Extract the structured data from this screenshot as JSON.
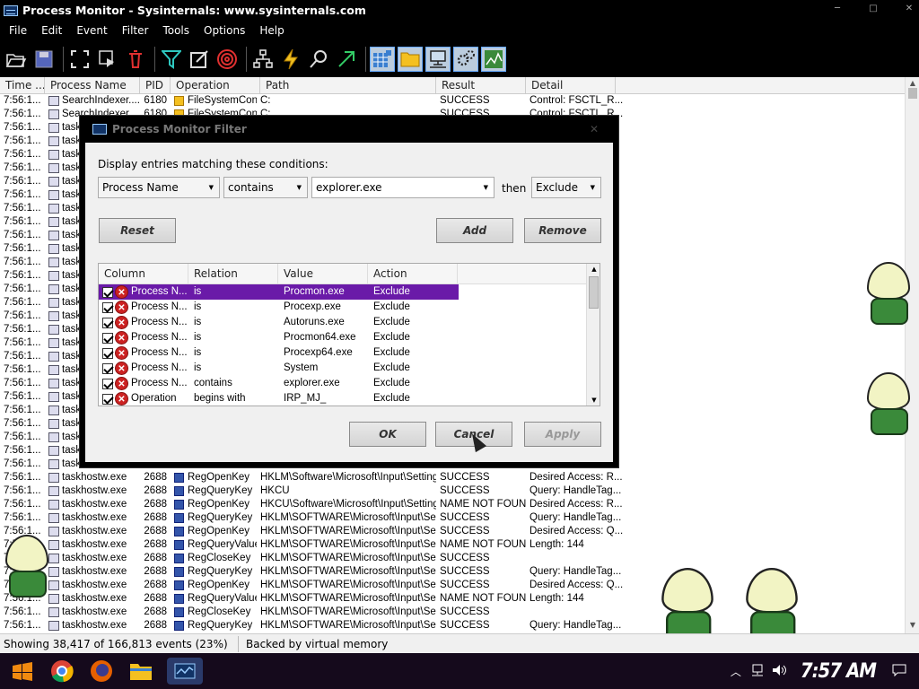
{
  "window": {
    "title": "Process Monitor - Sysinternals: www.sysinternals.com"
  },
  "menu": [
    "File",
    "Edit",
    "Event",
    "Filter",
    "Tools",
    "Options",
    "Help"
  ],
  "toolbar": [
    "open-icon",
    "save-icon",
    "autoscroll-icon",
    "clear-icon",
    "delete-icon",
    "filter-icon",
    "highlight-icon",
    "target-icon",
    "tree-icon",
    "capture-events-icon",
    "find-icon",
    "jump-icon",
    "registry-icon",
    "filesystem-icon",
    "network-icon",
    "process-icon",
    "profiling-icon"
  ],
  "columns": [
    "Time ...",
    "Process Name",
    "PID",
    "Operation",
    "Path",
    "Result",
    "Detail"
  ],
  "rows_top": [
    {
      "time": "7:56:1...",
      "proc": "SearchIndexer....",
      "pid": "6180",
      "op": "FileSystemControl",
      "path": "C:",
      "res": "SUCCESS",
      "det": "Control: FSCTL_R..."
    },
    {
      "time": "7:56:1...",
      "proc": "SearchIndexer....",
      "pid": "6180",
      "op": "FileSystemControl",
      "path": "C:",
      "res": "SUCCESS",
      "det": "Control: FSCTL_R..."
    }
  ],
  "rows_hidden_time": "7:56:1...",
  "rows_hidden_proc": "taskh",
  "rows_bottom": [
    {
      "time": "7:56:1...",
      "proc": "taskhostw.exe",
      "pid": "2688",
      "op": "RegOpenKey",
      "path": "HKLM\\Software\\Microsoft\\Input\\Settings",
      "res": "SUCCESS",
      "det": "Desired Access: R..."
    },
    {
      "time": "7:56:1...",
      "proc": "taskhostw.exe",
      "pid": "2688",
      "op": "RegQueryKey",
      "path": "HKCU",
      "res": "SUCCESS",
      "det": "Query: HandleTag..."
    },
    {
      "time": "7:56:1...",
      "proc": "taskhostw.exe",
      "pid": "2688",
      "op": "RegOpenKey",
      "path": "HKCU\\Software\\Microsoft\\Input\\Settings",
      "res": "NAME NOT FOUND",
      "det": "Desired Access: R..."
    },
    {
      "time": "7:56:1...",
      "proc": "taskhostw.exe",
      "pid": "2688",
      "op": "RegQueryKey",
      "path": "HKLM\\SOFTWARE\\Microsoft\\Input\\Se...",
      "res": "SUCCESS",
      "det": "Query: HandleTag..."
    },
    {
      "time": "7:56:1...",
      "proc": "taskhostw.exe",
      "pid": "2688",
      "op": "RegOpenKey",
      "path": "HKLM\\SOFTWARE\\Microsoft\\Input\\Se...",
      "res": "SUCCESS",
      "det": "Desired Access: Q..."
    },
    {
      "time": "7:56:1...",
      "proc": "taskhostw.exe",
      "pid": "2688",
      "op": "RegQueryValue",
      "path": "HKLM\\SOFTWARE\\Microsoft\\Input\\Se...",
      "res": "NAME NOT FOUND",
      "det": "Length: 144"
    },
    {
      "time": "7:56:1...",
      "proc": "taskhostw.exe",
      "pid": "2688",
      "op": "RegCloseKey",
      "path": "HKLM\\SOFTWARE\\Microsoft\\Input\\Se...",
      "res": "SUCCESS",
      "det": ""
    },
    {
      "time": "7:56:1...",
      "proc": "taskhostw.exe",
      "pid": "2688",
      "op": "RegQueryKey",
      "path": "HKLM\\SOFTWARE\\Microsoft\\Input\\Se...",
      "res": "SUCCESS",
      "det": "Query: HandleTag..."
    },
    {
      "time": "7:56:1...",
      "proc": "taskhostw.exe",
      "pid": "2688",
      "op": "RegOpenKey",
      "path": "HKLM\\SOFTWARE\\Microsoft\\Input\\Se...",
      "res": "SUCCESS",
      "det": "Desired Access: Q..."
    },
    {
      "time": "7:56:1...",
      "proc": "taskhostw.exe",
      "pid": "2688",
      "op": "RegQueryValue",
      "path": "HKLM\\SOFTWARE\\Microsoft\\Input\\Se...",
      "res": "NAME NOT FOUND",
      "det": "Length: 144"
    },
    {
      "time": "7:56:1...",
      "proc": "taskhostw.exe",
      "pid": "2688",
      "op": "RegCloseKey",
      "path": "HKLM\\SOFTWARE\\Microsoft\\Input\\Se...",
      "res": "SUCCESS",
      "det": ""
    },
    {
      "time": "7:56:1...",
      "proc": "taskhostw.exe",
      "pid": "2688",
      "op": "RegQueryKey",
      "path": "HKLM\\SOFTWARE\\Microsoft\\Input\\Se...",
      "res": "SUCCESS",
      "det": "Query: HandleTag..."
    },
    {
      "time": "7:56:1...",
      "proc": "taskhostw.exe",
      "pid": "2688",
      "op": "RegOpenKey",
      "path": "HKLM\\SOFTWARE\\Microsoft\\Input\\Se...",
      "res": "SUCCESS",
      "det": "Desired Access: Q..."
    }
  ],
  "status": {
    "events": "Showing 38,417 of 166,813 events (23%)",
    "memory": "Backed by virtual memory"
  },
  "dialog": {
    "title": "Process Monitor Filter",
    "prompt": "Display entries matching these conditions:",
    "column_select": "Process Name",
    "relation_select": "contains",
    "value_input": "explorer.exe",
    "then_label": "then",
    "action_select": "Exclude",
    "reset": "Reset",
    "add": "Add",
    "remove": "Remove",
    "ok": "OK",
    "cancel": "Cancel",
    "apply": "Apply",
    "headers": [
      "Column",
      "Relation",
      "Value",
      "Action"
    ],
    "filters": [
      {
        "col": "Process N...",
        "rel": "is",
        "val": "Procmon.exe",
        "act": "Exclude"
      },
      {
        "col": "Process N...",
        "rel": "is",
        "val": "Procexp.exe",
        "act": "Exclude"
      },
      {
        "col": "Process N...",
        "rel": "is",
        "val": "Autoruns.exe",
        "act": "Exclude"
      },
      {
        "col": "Process N...",
        "rel": "is",
        "val": "Procmon64.exe",
        "act": "Exclude"
      },
      {
        "col": "Process N...",
        "rel": "is",
        "val": "Procexp64.exe",
        "act": "Exclude"
      },
      {
        "col": "Process N...",
        "rel": "is",
        "val": "System",
        "act": "Exclude"
      },
      {
        "col": "Process N...",
        "rel": "contains",
        "val": "explorer.exe",
        "act": "Exclude"
      },
      {
        "col": "Operation",
        "rel": "begins with",
        "val": "IRP_MJ_",
        "act": "Exclude"
      }
    ]
  },
  "taskbar": {
    "clock": "7:57 AM",
    "apps": [
      "start-icon",
      "chrome-icon",
      "firefox-icon",
      "file-explorer-icon",
      "procmon-taskbar-icon"
    ]
  },
  "colors": {
    "selection": "#6a1aa8",
    "chrome": "#000000"
  }
}
